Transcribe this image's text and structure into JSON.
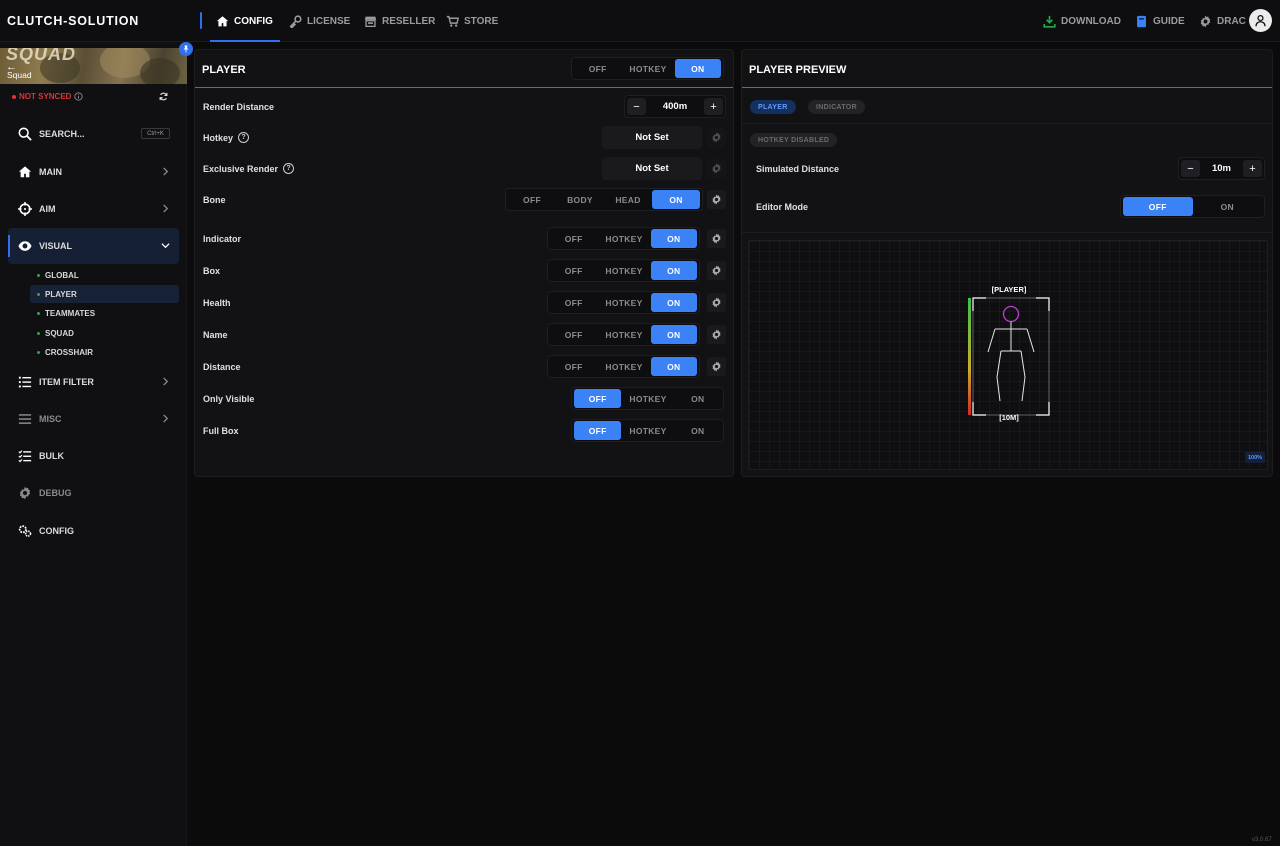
{
  "brand": "CLUTCH-SOLUTION",
  "tabs": [
    {
      "label": "CONFIG",
      "icon": "home-icon"
    },
    {
      "label": "LICENSE",
      "icon": "key-icon"
    },
    {
      "label": "RESELLER",
      "icon": "store-icon"
    },
    {
      "label": "STORE",
      "icon": "cart-icon"
    }
  ],
  "topright": {
    "download": "DOWNLOAD",
    "guide": "GUIDE",
    "user": "DRAC"
  },
  "colors": {
    "accent": "#3a82f6",
    "download_icon": "#27a64a",
    "error": "#e03434"
  },
  "sidebar": {
    "game_title": "SQUAD",
    "game_name": "Squad",
    "back_glyph": "←",
    "sync_status": "NOT SYNCED",
    "search": {
      "label": "SEARCH...",
      "shortcut": "Ctrl+K"
    },
    "items": [
      {
        "label": "MAIN",
        "icon": "home-icon"
      },
      {
        "label": "AIM",
        "icon": "crosshair-icon"
      },
      {
        "label": "VISUAL",
        "icon": "eye-icon"
      },
      {
        "label": "ITEM FILTER",
        "icon": "list-icon"
      },
      {
        "label": "MISC",
        "icon": "menu-icon"
      },
      {
        "label": "BULK",
        "icon": "checklist-icon"
      },
      {
        "label": "DEBUG",
        "icon": "gear-icon"
      },
      {
        "label": "CONFIG",
        "icon": "gears-icon"
      }
    ],
    "visual_sub": [
      "GLOBAL",
      "PLAYER",
      "TEAMMATES",
      "SQUAD",
      "CROSSHAIR"
    ]
  },
  "player": {
    "title": "PLAYER",
    "master": {
      "options": [
        "OFF",
        "HOTKEY",
        "ON"
      ],
      "selected": "ON"
    },
    "render_distance": {
      "label": "Render Distance",
      "value": "400m",
      "minus": "−",
      "plus": "+"
    },
    "hotkey": {
      "label": "Hotkey",
      "value": "Not Set"
    },
    "exclusive_render": {
      "label": "Exclusive Render",
      "value": "Not Set"
    },
    "help_glyph": "?",
    "bone": {
      "label": "Bone",
      "options": [
        "OFF",
        "BODY",
        "HEAD",
        "ON"
      ],
      "selected": "ON"
    },
    "rows": [
      {
        "label": "Indicator",
        "options": [
          "OFF",
          "HOTKEY",
          "ON"
        ],
        "selected": "ON"
      },
      {
        "label": "Box",
        "options": [
          "OFF",
          "HOTKEY",
          "ON"
        ],
        "selected": "ON"
      },
      {
        "label": "Health",
        "options": [
          "OFF",
          "HOTKEY",
          "ON"
        ],
        "selected": "ON"
      },
      {
        "label": "Name",
        "options": [
          "OFF",
          "HOTKEY",
          "ON"
        ],
        "selected": "ON"
      },
      {
        "label": "Distance",
        "options": [
          "OFF",
          "HOTKEY",
          "ON"
        ],
        "selected": "ON"
      },
      {
        "label": "Only Visible",
        "options": [
          "OFF",
          "HOTKEY",
          "ON"
        ],
        "selected": "OFF"
      },
      {
        "label": "Full Box",
        "options": [
          "OFF",
          "HOTKEY",
          "ON"
        ],
        "selected": "OFF"
      }
    ]
  },
  "preview": {
    "title": "PLAYER PREVIEW",
    "pills": {
      "player": "PLAYER",
      "indicator": "INDICATOR"
    },
    "hotkey_badge": "HOTKEY DISABLED",
    "simulated_distance": {
      "label": "Simulated Distance",
      "value": "10m",
      "minus": "−",
      "plus": "+"
    },
    "editor_mode": {
      "label": "Editor Mode",
      "options": [
        "OFF",
        "ON"
      ],
      "selected": "OFF"
    },
    "canvas": {
      "name_tag": "[PLAYER]",
      "distance_tag": "[10M]",
      "zoom": "100%",
      "health": 1.0
    }
  },
  "version": "v3.0.67"
}
